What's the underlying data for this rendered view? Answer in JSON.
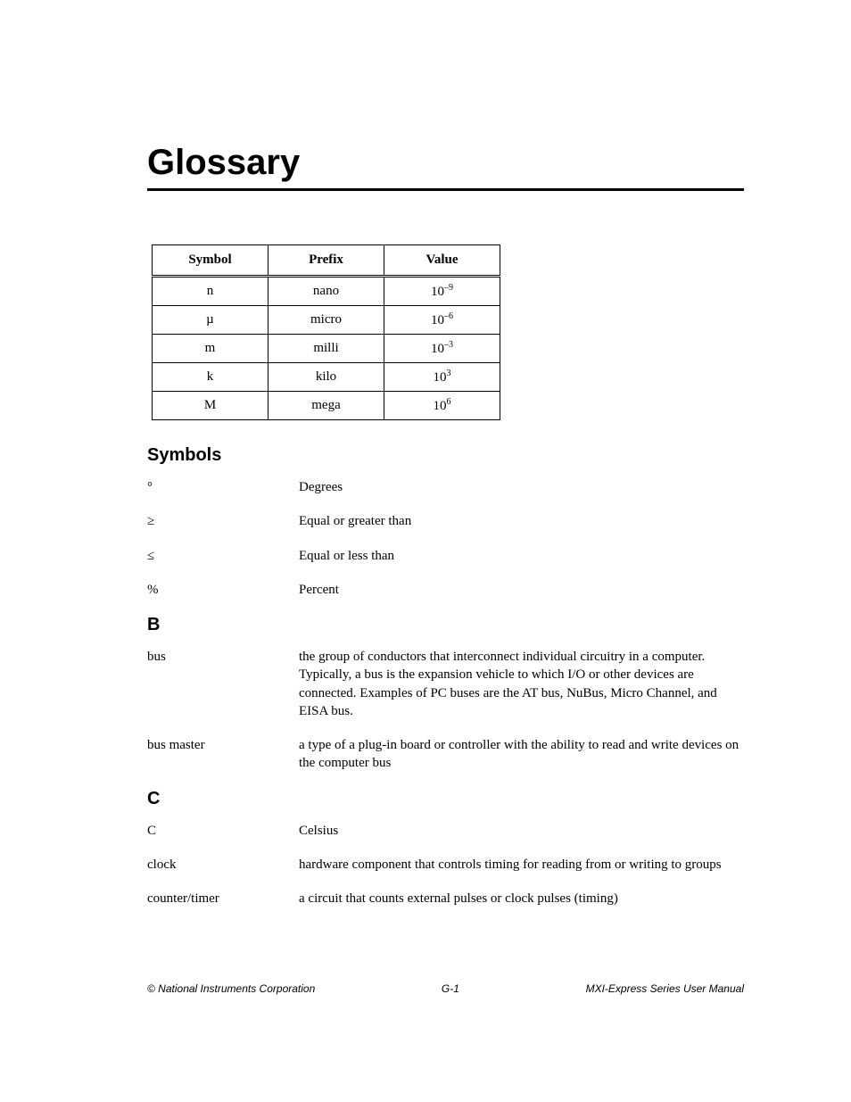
{
  "title": "Glossary",
  "prefix_table": {
    "headers": [
      "Symbol",
      "Prefix",
      "Value"
    ],
    "rows": [
      {
        "symbol": "n",
        "prefix": "nano",
        "base": "10",
        "exp": "–9"
      },
      {
        "symbol": "µ",
        "prefix": "micro",
        "base": "10",
        "exp": "–6"
      },
      {
        "symbol": "m",
        "prefix": "milli",
        "base": "10",
        "exp": "–3"
      },
      {
        "symbol": "k",
        "prefix": "kilo",
        "base": "10",
        "exp": "3"
      },
      {
        "symbol": "M",
        "prefix": "mega",
        "base": "10",
        "exp": "6"
      }
    ]
  },
  "sections": {
    "symbols": {
      "heading": "Symbols",
      "entries": [
        {
          "term": "°",
          "def": "Degrees"
        },
        {
          "term": "≥",
          "def": "Equal or greater than"
        },
        {
          "term": "≤",
          "def": "Equal or less than"
        },
        {
          "term": "%",
          "def": "Percent"
        }
      ]
    },
    "b": {
      "heading": "B",
      "entries": [
        {
          "term": "bus",
          "def": "the group of conductors that interconnect individual circuitry in a computer. Typically, a bus is the expansion vehicle to which I/O or other devices are connected. Examples of PC buses are the AT bus, NuBus, Micro Channel, and EISA bus."
        },
        {
          "term": "bus master",
          "def": "a type of a plug-in board or controller with the ability to read and write devices on the computer bus"
        }
      ]
    },
    "c": {
      "heading": "C",
      "entries": [
        {
          "term": "C",
          "def": "Celsius"
        },
        {
          "term": "clock",
          "def": "hardware component that controls timing for reading from or writing to groups"
        },
        {
          "term": "counter/timer",
          "def": "a circuit that counts external pulses or clock pulses (timing)"
        }
      ]
    }
  },
  "footer": {
    "left": "© National Instruments Corporation",
    "center": "G-1",
    "right": "MXI-Express Series User Manual"
  }
}
